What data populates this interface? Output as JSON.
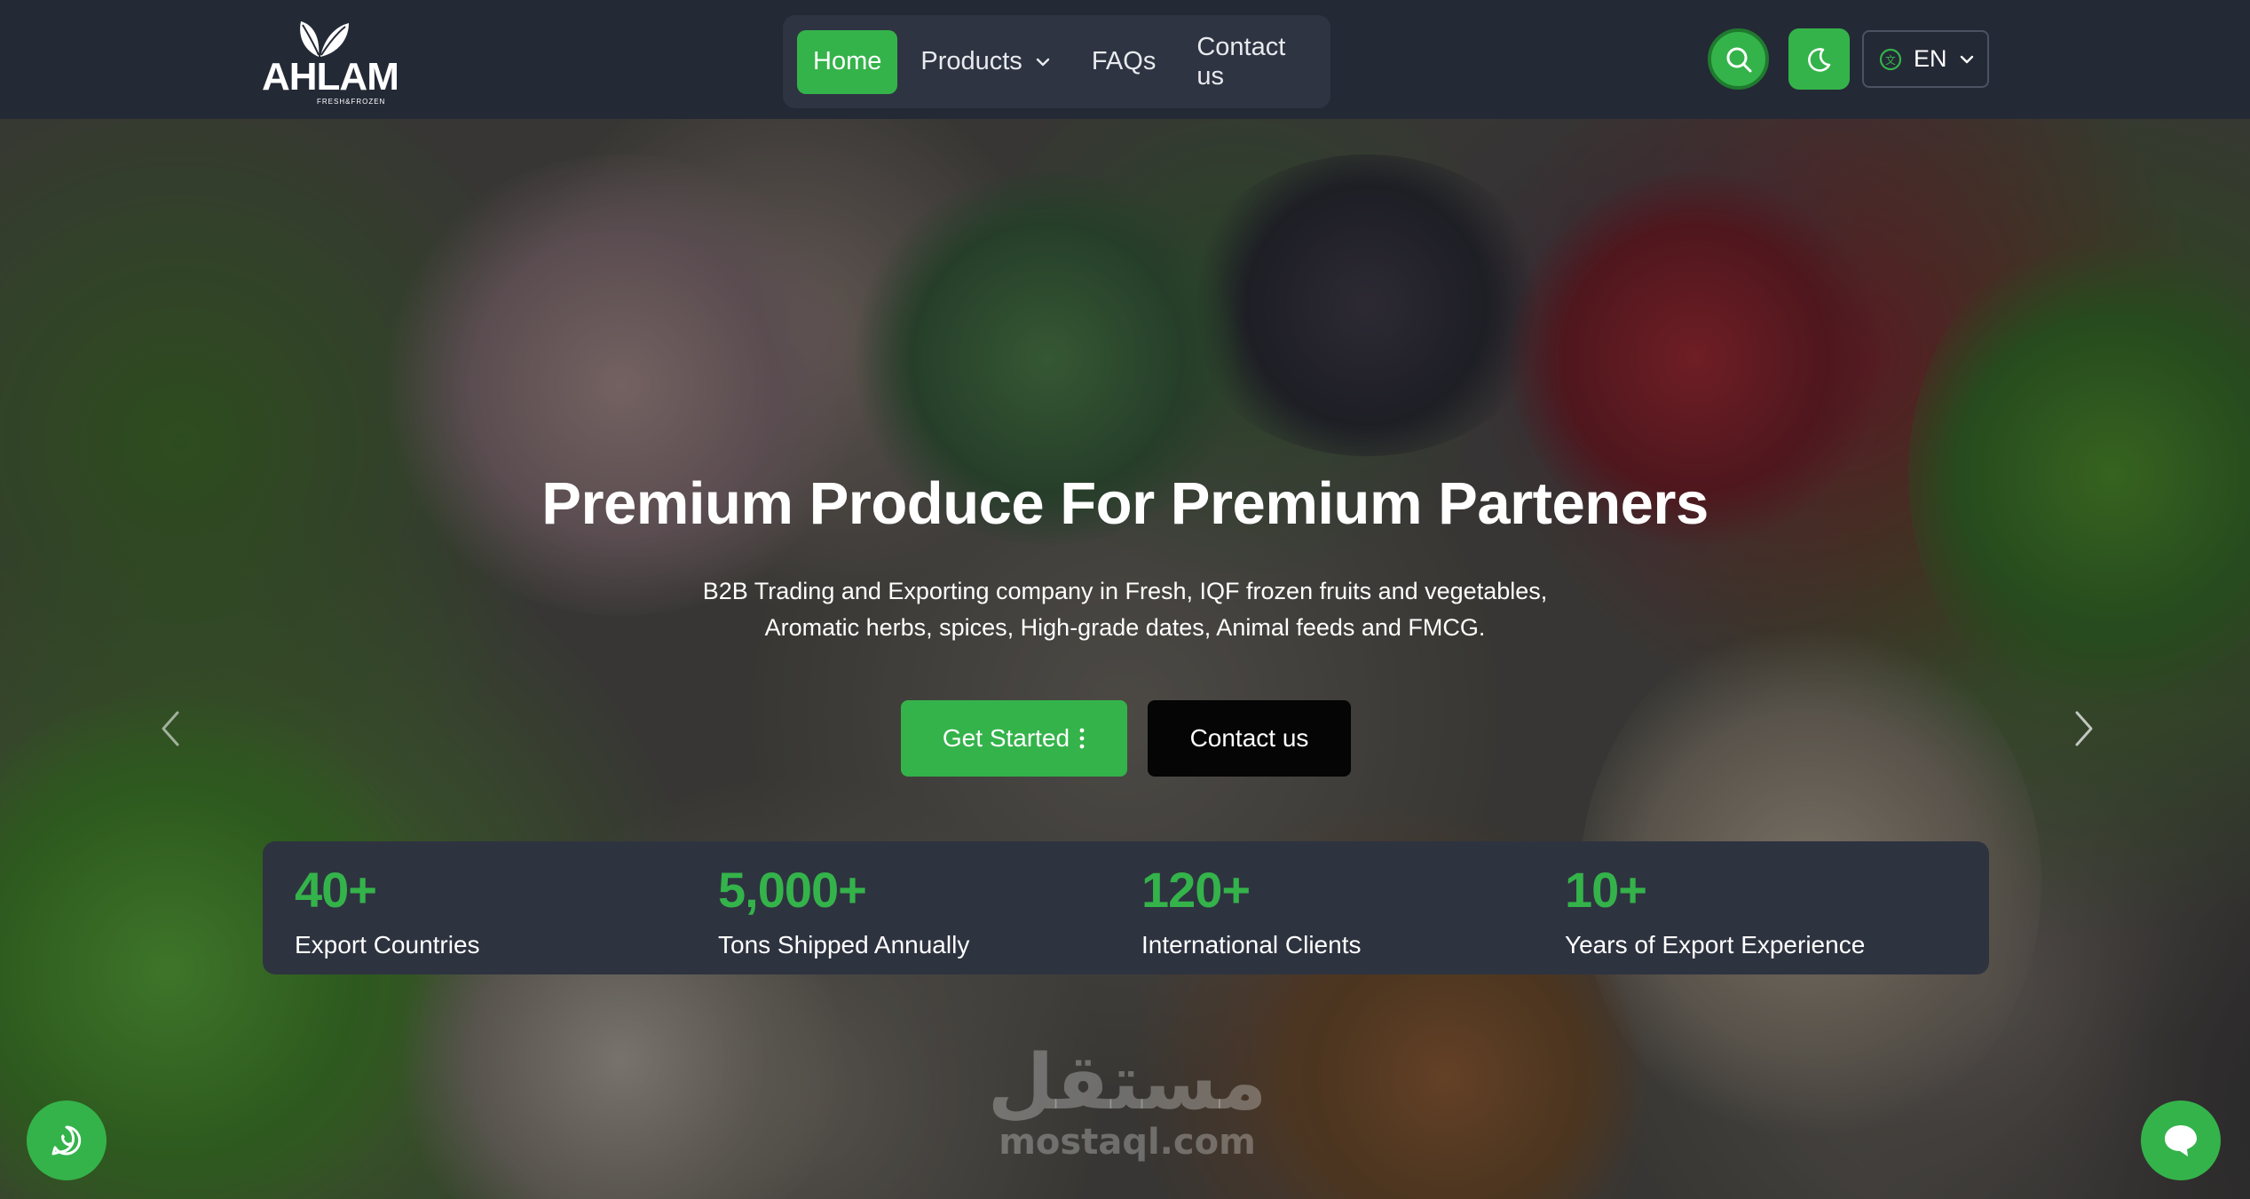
{
  "brand": {
    "name": "AHLAM",
    "tagline": "FRESH&FROZEN",
    "accent_color": "#34b34a"
  },
  "nav": {
    "items": [
      {
        "label": "Home",
        "active": true
      },
      {
        "label": "Products",
        "has_dropdown": true
      },
      {
        "label": "FAQs"
      },
      {
        "label": "Contact us"
      }
    ]
  },
  "header_actions": {
    "search_icon": "search-icon",
    "theme_icon": "moon-icon",
    "language": "EN"
  },
  "hero": {
    "title": "Premium Produce For Premium Parteners",
    "subtitle_line1": "B2B Trading and Exporting company in Fresh, IQF frozen fruits and vegetables,",
    "subtitle_line2": "Aromatic herbs, spices, High-grade dates, Animal feeds and FMCG.",
    "primary_button": "Get Started",
    "secondary_button": "Contact us"
  },
  "stats": [
    {
      "value": "40+",
      "label": "Export Countries"
    },
    {
      "value": "5,000+",
      "label": "Tons Shipped Annually"
    },
    {
      "value": "120+",
      "label": "International Clients"
    },
    {
      "value": "10+",
      "label": "Years of Export Experience"
    }
  ],
  "watermark": {
    "arabic": "مستقل",
    "latin": "mostaql.com"
  }
}
